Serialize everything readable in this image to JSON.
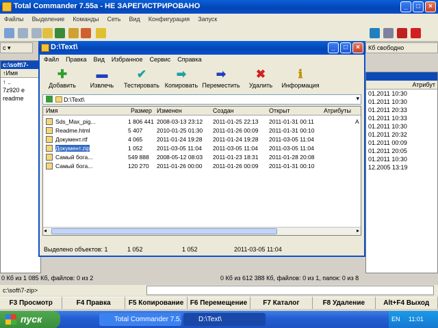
{
  "main_window": {
    "title": "Total Commander 7.55a - НЕ ЗАРЕГИСТРИРОВАНО",
    "menu": [
      "Файлы",
      "Выделение",
      "Команды",
      "Сеть",
      "Вид",
      "Конфигурация",
      "Запуск"
    ],
    "left_panel": {
      "drive": "c",
      "path": "c:\\soft\\7-",
      "col_name": "↑Имя",
      "items": [
        "7z920 e",
        "readme"
      ],
      "status": "0 Кб из 1 085 Кб, файлов: 0 из 2"
    },
    "right_panel": {
      "free": "Кб свободно",
      "col_attr": "Атрибут",
      "dates": [
        "01.2011 10:30",
        "01.2011 10:30",
        "01.2011 20:33",
        "01.2011 10:33",
        "01.2011 10:30",
        "01.2011 20:32",
        "01.2011 00:09",
        "01.2011 20:05",
        "01.2011 10:30",
        "12.2005 13:19"
      ],
      "status": "0 Кб из 612 388 Кб, файлов: 0 из 1, папок: 0 из 8"
    },
    "cmdline_path": "c:\\soft\\7-zip>",
    "fkeys": [
      "F3 Просмотр",
      "F4 Правка",
      "F5 Копирование",
      "F6 Перемещение",
      "F7 Каталог",
      "F8 Удаление",
      "Alt+F4 Выход"
    ]
  },
  "dialog": {
    "title": "D:\\Text\\",
    "menu": [
      "Файл",
      "Правка",
      "Вид",
      "Избранное",
      "Сервис",
      "Справка"
    ],
    "toolbar": [
      {
        "label": "Добавить",
        "glyph": "✚",
        "color": "#2ca02c"
      },
      {
        "label": "Извлечь",
        "glyph": "▬",
        "color": "#1f3fbf"
      },
      {
        "label": "Тестировать",
        "glyph": "✔",
        "color": "#20a0a0"
      },
      {
        "label": "Копировать",
        "glyph": "➡",
        "color": "#20a0a0"
      },
      {
        "label": "Переместить",
        "glyph": "➡",
        "color": "#1f3fbf"
      },
      {
        "label": "Удалить",
        "glyph": "✖",
        "color": "#d02020"
      },
      {
        "label": "Информация",
        "glyph": "ℹ",
        "color": "#c09000"
      }
    ],
    "path": "D:\\Text\\",
    "columns": [
      "Имя",
      "Размер",
      "Изменен",
      "Создан",
      "Открыт",
      "Атрибуты"
    ],
    "attr_short": "A",
    "files": [
      {
        "name": "Sds_Max_pig...",
        "size": "1 806 441",
        "modified": "2008-03-13 23:12",
        "created": "2011-01-25 22:13",
        "opened": "2011-01-31 00:11",
        "attr": "A",
        "selected": false
      },
      {
        "name": "Readme.html",
        "size": "5 407",
        "modified": "2010-01-25 01:30",
        "created": "2011-01-26 00:09",
        "opened": "2011-01-31 00:10",
        "attr": "",
        "selected": false
      },
      {
        "name": "Документ.rtf",
        "size": "4 065",
        "modified": "2011-01-24 19:28",
        "created": "2011-01-24 19:28",
        "opened": "2011-03-05 11:04",
        "attr": "",
        "selected": false
      },
      {
        "name": "Документ.zip",
        "size": "1 052",
        "modified": "2011-03-05 11:04",
        "created": "2011-03-05 11:04",
        "opened": "2011-03-05 11:04",
        "attr": "",
        "selected": true
      },
      {
        "name": "Самый бога...",
        "size": "549 888",
        "modified": "2008-05-12 08:03",
        "created": "2011-01-23 18:31",
        "opened": "2011-01-28 20:08",
        "attr": "",
        "selected": false
      },
      {
        "name": "Самый бога...",
        "size": "120 270",
        "modified": "2011-01-26 00:00",
        "created": "2011-01-26 00:09",
        "opened": "2011-01-31 00:10",
        "attr": "",
        "selected": false
      }
    ],
    "status": {
      "selected": "Выделено объектов: 1",
      "size1": "1 052",
      "size2": "1 052",
      "date": "2011-03-05 11:04"
    }
  },
  "taskbar": {
    "start": "пуск",
    "tasks": [
      "Total Commander 7.5...",
      "D:\\Text\\"
    ],
    "lang": "EN",
    "clock": "11:01"
  }
}
